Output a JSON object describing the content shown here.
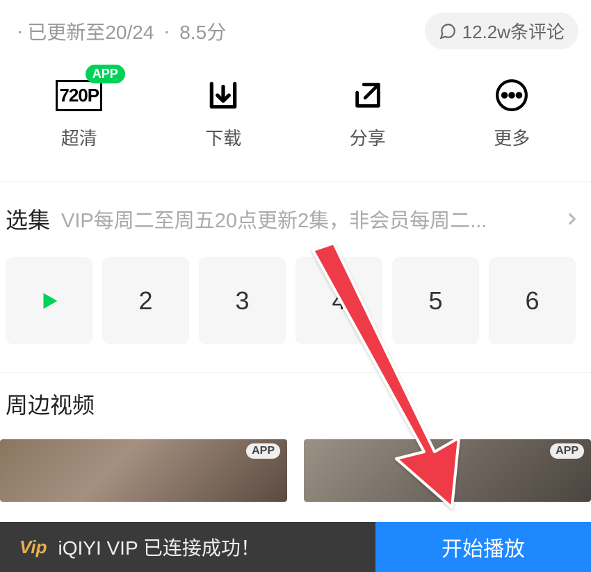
{
  "meta": {
    "update_status": "已更新至20/24",
    "rating": "8.5分",
    "comments": "12.2w条评论"
  },
  "actions": {
    "quality": {
      "text": "720P",
      "label": "超清",
      "badge": "APP"
    },
    "download": {
      "label": "下载"
    },
    "share": {
      "label": "分享"
    },
    "more": {
      "label": "更多"
    }
  },
  "episodes": {
    "title": "选集",
    "desc": "VIP每周二至周五20点更新2集，非会员每周二...",
    "items": [
      "playing",
      "2",
      "3",
      "4",
      "5",
      "6"
    ]
  },
  "side_videos": {
    "title": "周边视频",
    "thumb_badge": "APP"
  },
  "bottom": {
    "vip": "Vip",
    "status": "iQIYI VIP 已连接成功！",
    "play_btn": "开始播放"
  }
}
